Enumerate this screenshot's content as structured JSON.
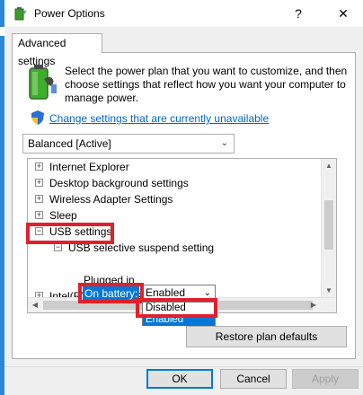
{
  "window": {
    "title": "Power Options",
    "help_glyph": "?",
    "close_glyph": "✕"
  },
  "tab": {
    "label": "Advanced settings"
  },
  "description": "Select the power plan that you want to customize, and then choose settings that reflect how you want your computer to manage power.",
  "change_link": "Change settings that are currently unavailable",
  "plan_select": {
    "value": "Balanced [Active]"
  },
  "tree": {
    "items": [
      {
        "label": "Internet Explorer",
        "expander": "+"
      },
      {
        "label": "Desktop background settings",
        "expander": "+"
      },
      {
        "label": "Wireless Adapter Settings",
        "expander": "+"
      },
      {
        "label": "Sleep",
        "expander": "+"
      },
      {
        "label": "USB settings",
        "expander": "−"
      },
      {
        "label": "USB selective suspend setting",
        "expander": "−"
      },
      {
        "label": "On battery:"
      },
      {
        "label": "Plugged in"
      },
      {
        "label": "Intel(R) Graphics Settings",
        "expander": "+"
      }
    ],
    "on_battery_value": "Enabled",
    "dropdown_options": [
      "Disabled",
      "Enabled"
    ]
  },
  "buttons": {
    "restore": "Restore plan defaults",
    "ok": "OK",
    "cancel": "Cancel",
    "apply": "Apply"
  },
  "colors": {
    "accent": "#0078d7",
    "highlight": "#e0202a",
    "link": "#0066cc"
  }
}
